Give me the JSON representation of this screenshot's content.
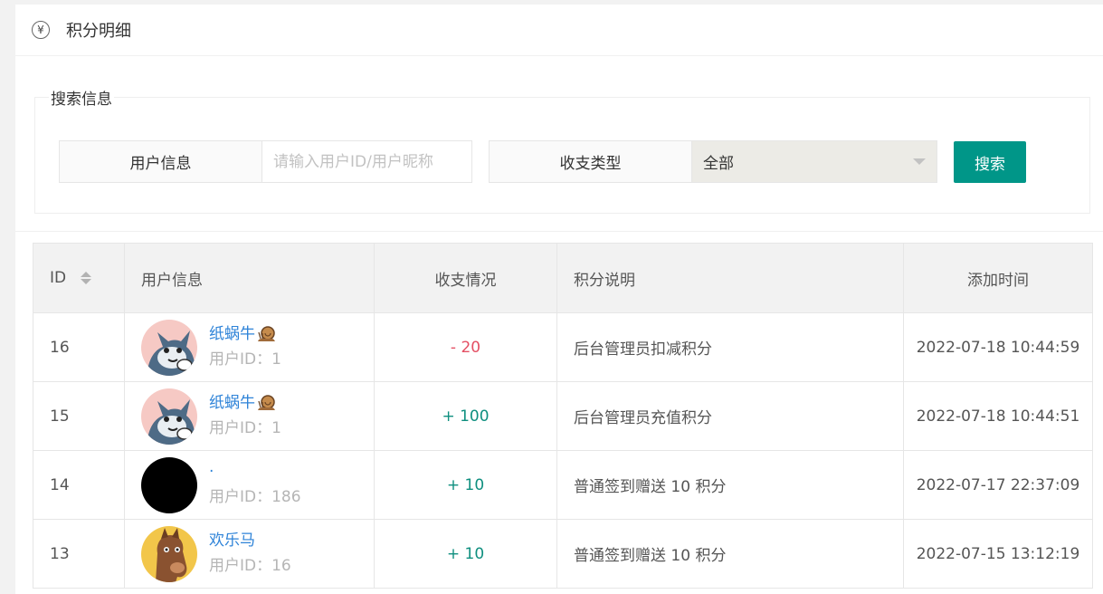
{
  "header": {
    "title": "积分明细",
    "icon": "yen-icon"
  },
  "search": {
    "legend": "搜索信息",
    "user_label": "用户信息",
    "user_placeholder": "请输入用户ID/用户昵称",
    "type_label": "收支类型",
    "type_value": "全部",
    "button": "搜索"
  },
  "table": {
    "columns": [
      "ID",
      "用户信息",
      "收支情况",
      "积分说明",
      "添加时间"
    ],
    "uid_prefix": "用户ID：",
    "rows": [
      {
        "id": "16",
        "nickname": "纸蜗牛",
        "badge": "snail-icon",
        "avatar": "cat",
        "uid": "1",
        "amount": "- 20",
        "sign": "minus",
        "desc": "后台管理员扣减积分",
        "time": "2022-07-18 10:44:59"
      },
      {
        "id": "15",
        "nickname": "纸蜗牛",
        "badge": "snail-icon",
        "avatar": "cat",
        "uid": "1",
        "amount": "+ 100",
        "sign": "plus",
        "desc": "后台管理员充值积分",
        "time": "2022-07-18 10:44:51"
      },
      {
        "id": "14",
        "nickname": "·",
        "badge": "",
        "avatar": "black",
        "uid": "186",
        "amount": "+ 10",
        "sign": "plus",
        "desc": "普通签到赠送 10 积分",
        "time": "2022-07-17 22:37:09"
      },
      {
        "id": "13",
        "nickname": "欢乐马",
        "badge": "",
        "avatar": "horse",
        "uid": "16",
        "amount": "+ 10",
        "sign": "plus",
        "desc": "普通签到赠送 10 积分",
        "time": "2022-07-15 13:12:19"
      }
    ]
  },
  "colors": {
    "primary": "#009688",
    "link": "#2e83d8",
    "minus": "#e45064",
    "plus": "#0f8f7f"
  }
}
